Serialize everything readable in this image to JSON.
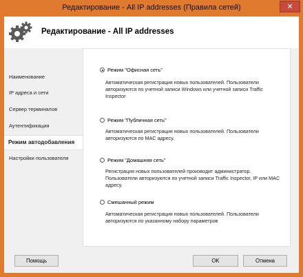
{
  "window": {
    "title": "Редактирование - All IP addresses (Правила сетей)",
    "close_glyph": "✕"
  },
  "header": {
    "title": "Редактирование - All IP addresses"
  },
  "sidebar": {
    "items": [
      {
        "label": "Наименование",
        "active": false
      },
      {
        "label": "IP адреса и сети",
        "active": false
      },
      {
        "label": "Сервер терминалов",
        "active": false
      },
      {
        "label": "Аутентификация",
        "active": false
      },
      {
        "label": "Режим автодобавления",
        "active": true
      },
      {
        "label": "Настройки пользователя",
        "active": false
      }
    ]
  },
  "modes": [
    {
      "label": "Режим \"Офисная сеть\"",
      "checked": true,
      "description": "Автоматическая регистрация новых пользователей. Пользователи авторизуются по учетной записи Windows или учетной записи Traffic Inspector"
    },
    {
      "label": "Режим \"Публичная сеть\"",
      "checked": false,
      "description": "Автоматическая регистрация новых пользователей. Пользователи авторизуются по MAC адресу."
    },
    {
      "label": "Режим \"Домашняя сеть\"",
      "checked": false,
      "description": "Регистрация новых пользователей производит администратор. Пользователи авторизуются по учетной записи Traffic Inspector, IP или MAC адресу."
    },
    {
      "label": "Смешанный режим",
      "checked": false,
      "description": "Автоматическая регистрация новых пользователей. Пользователи авторизуются по указанному набору параметров"
    }
  ],
  "buttons": {
    "help": "Помощь",
    "ok": "OK",
    "cancel": "Отмена"
  },
  "colors": {
    "frame": "#e07a2e",
    "close": "#c74a3a"
  }
}
